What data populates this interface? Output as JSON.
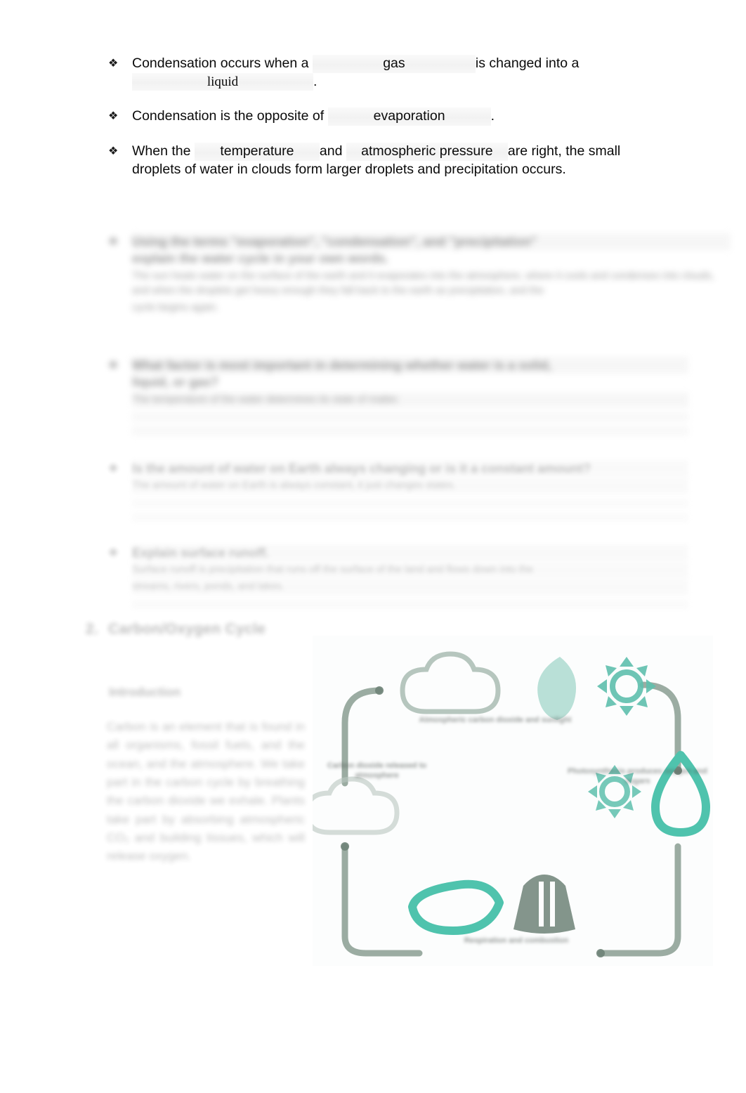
{
  "worksheet": {
    "bullet_glyph": "❖",
    "questions": [
      {
        "id": "q-condensation-definition",
        "pre": "Condensation occurs when a",
        "answer1": "gas",
        "mid": "is changed into a",
        "answer2": "liquid",
        "post": "."
      },
      {
        "id": "q-condensation-opposite",
        "pre": "Condensation is the opposite of",
        "answer1": "evaporation",
        "post": "."
      },
      {
        "id": "q-precipitation-conditions",
        "pre": "When the",
        "answer1": "temperature",
        "mid": "and",
        "answer2": "atmospheric pressure",
        "post": "are right, the small droplets of water in clouds form larger droplets and precipitation occurs."
      }
    ],
    "blurred_questions": [
      {
        "id": "q-water-cycle-terms",
        "prompt_line1": "Using the terms \"evaporation\", \"condensation\", and \"precipitation\"",
        "prompt_line2": "explain the water cycle in your own words.",
        "answer_line1": "The sun heats water on the surface of the earth and it evaporates into the atmosphere, where it cools and condenses into clouds, and when the droplets get heavy enough they fall back to the earth as precipitation, and the",
        "answer_line2": "cycle begins again."
      },
      {
        "id": "q-water-state-factor",
        "prompt_line1": "What factor is most important in determining whether water is a solid,",
        "prompt_line2": "liquid, or gas?",
        "answer_line1": "The temperature of the water determines its state of matter."
      },
      {
        "id": "q-water-amount-constant",
        "prompt_line1": "Is the amount of water on Earth always changing or is it a constant amount?",
        "answer_line1": "The amount of water on Earth is always constant, it just changes states."
      },
      {
        "id": "q-define-surface-runoff",
        "prompt_line1": "Explain surface runoff.",
        "answer_line1": "Surface runoff is precipitation that runs off the surface of the land and flows down into the",
        "answer_line2": "streams, rivers, ponds, and lakes."
      }
    ],
    "section": {
      "number": "2.",
      "title": "Carbon/Oxygen Cycle",
      "subhead": "Introduction",
      "body": "Carbon is an element that is found in all organisms, fossil fuels, and the ocean, and the atmosphere. We take part in the carbon cycle by breathing the carbon dioxide we exhale. Plants take part by absorbing atmospheric CO₂ and building tissues, which will release oxygen."
    },
    "diagram": {
      "title": "carbon-oxygen-cycle-diagram",
      "accent_teal": "#5fc0ae",
      "accent_sage": "#8a9e92",
      "labels": {
        "top": "Atmospheric carbon dioxide and sunlight",
        "left": "Carbon dioxide released to atmosphere",
        "right": "Photosynthesis produces oxygen and sugars",
        "bottom": "Respiration and combustion"
      },
      "icons": [
        "cloud-icon",
        "leaf-icon",
        "sun-icon",
        "cloud-icon",
        "sun-icon",
        "water-drop-icon",
        "leaf-icon",
        "factory-icon"
      ]
    }
  }
}
